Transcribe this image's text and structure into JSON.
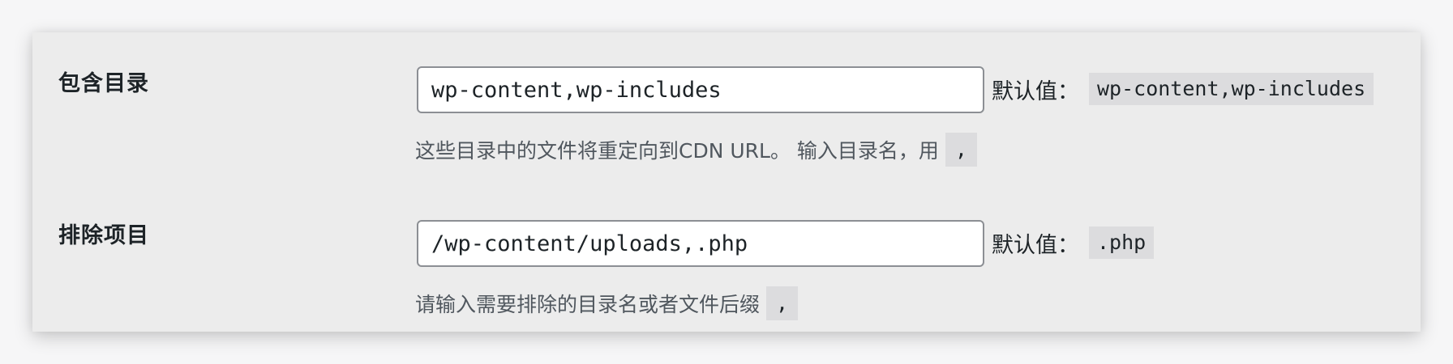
{
  "settings": {
    "include_dirs": {
      "label": "包含目录",
      "value": "wp-content,wp-includes",
      "default_label": "默认值：",
      "default_value": "wp-content,wp-includes",
      "description": "这些目录中的文件将重定向到CDN URL。 输入目录名，用",
      "separator": ","
    },
    "exclude_items": {
      "label": "排除项目",
      "value": "/wp-content/uploads,.php",
      "default_label": "默认值：",
      "default_value": ".php",
      "description": "请输入需要排除的目录名或者文件后缀",
      "separator": ","
    }
  }
}
